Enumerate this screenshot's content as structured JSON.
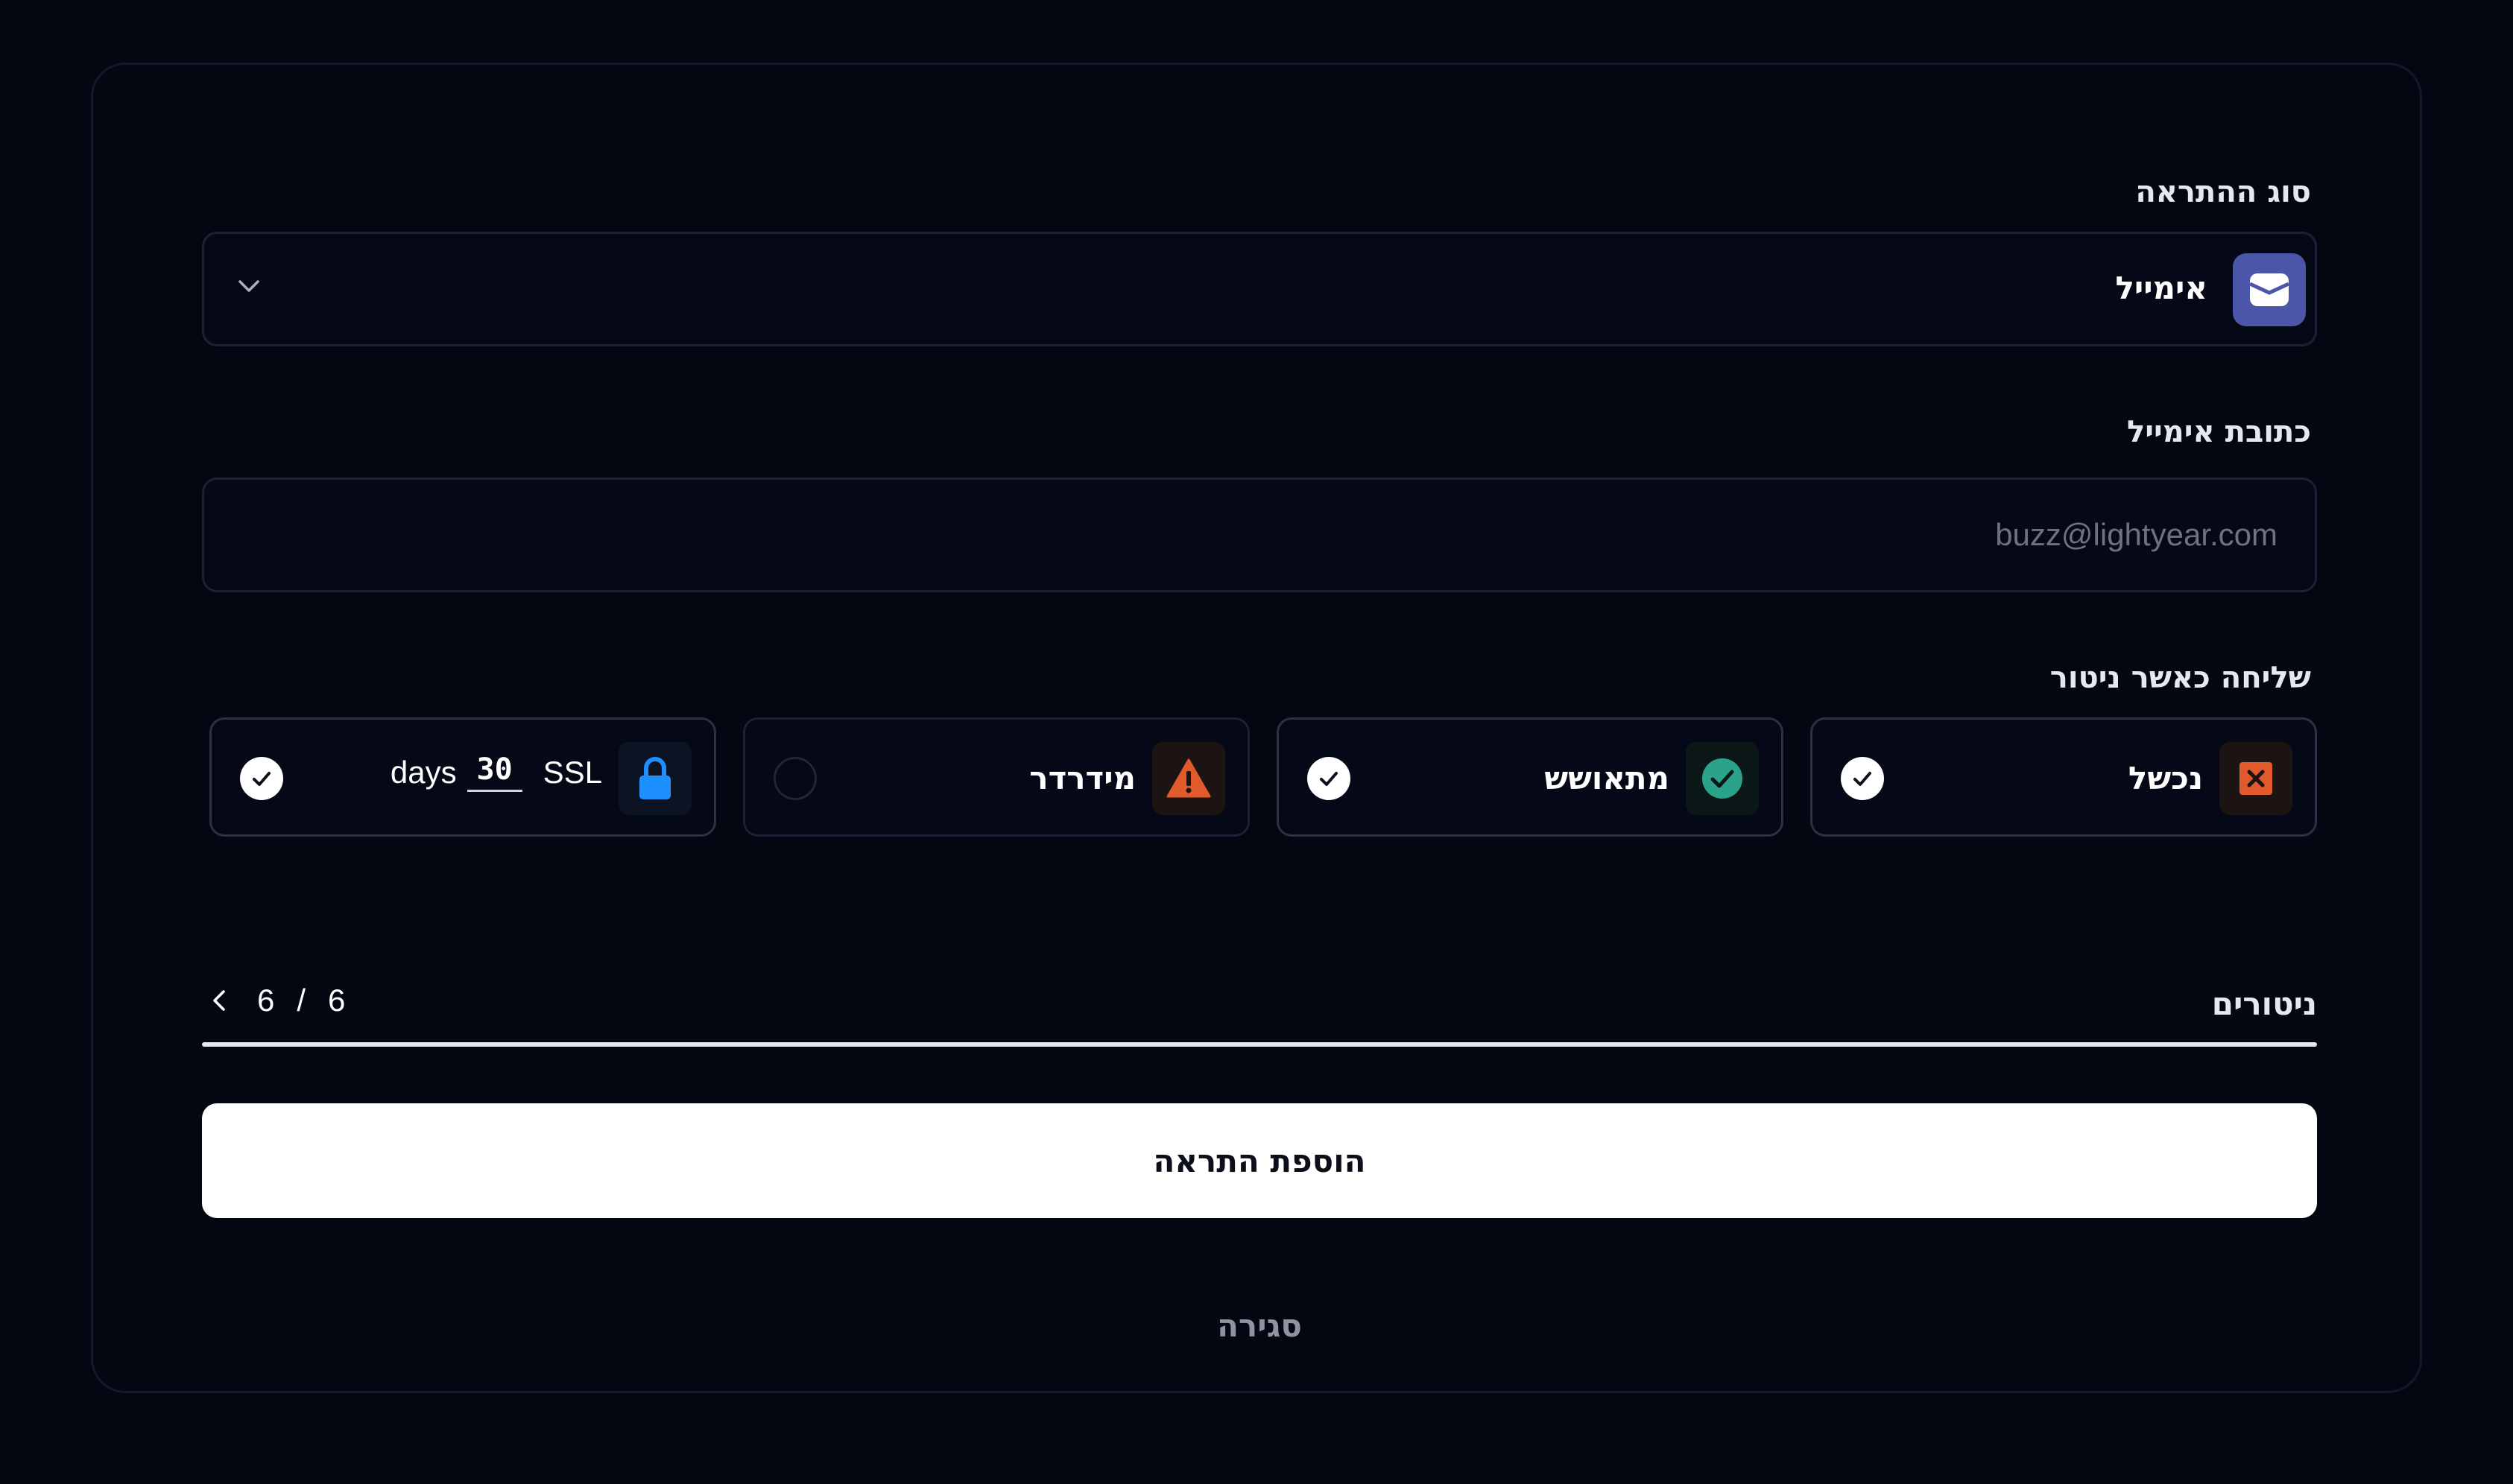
{
  "notification_type": {
    "label": "סוג ההתראה",
    "selected": "אימייל",
    "icon": "email-icon",
    "accent": "#4b56a8"
  },
  "email": {
    "label": "כתובת אימייל",
    "value": "",
    "placeholder": "buzz@lightyear.com"
  },
  "send_when": {
    "label": "שליחה כאשר ניטור",
    "options": [
      {
        "label": "נכשל",
        "icon": "x-icon",
        "color": "#e05a2b",
        "checked": true
      },
      {
        "label": "מתאושש",
        "icon": "check-circle-icon",
        "color": "#2aa38a",
        "checked": true
      },
      {
        "label": "מידרדר",
        "icon": "warning-icon",
        "color": "#e05a2b",
        "checked": false
      },
      {
        "label": "SSL",
        "icon": "lock-icon",
        "color": "#1e8fff",
        "checked": true,
        "days_value": "30",
        "days_unit": "days"
      }
    ]
  },
  "monitors": {
    "label": "ניטורים",
    "selected": "6",
    "separator": "/",
    "total": "6",
    "progress": 1.0
  },
  "actions": {
    "add_label": "הוספת התראה",
    "close_label": "סגירה"
  }
}
